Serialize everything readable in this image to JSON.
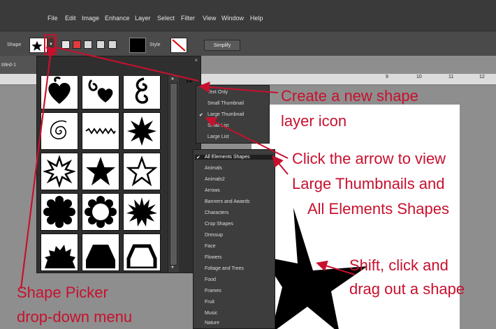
{
  "menu": {
    "items": [
      "File",
      "Edit",
      "Image",
      "Enhance",
      "Layer",
      "Select",
      "Filter",
      "View",
      "Window",
      "Help"
    ]
  },
  "options_bar": {
    "shape_label": "Shape",
    "style_label": "Style",
    "simplify_label": "Simplify"
  },
  "document": {
    "tab_title": "titled-1",
    "ruler_numbers": [
      "9",
      "10",
      "11",
      "12"
    ]
  },
  "picker": {
    "close_label": "×",
    "menu_arrow": "▸▸",
    "shapes": [
      "heart-flourish-icon",
      "heart-scroll-icon",
      "scroll-ornament-icon",
      "spiral-icon",
      "zigzag-line-icon",
      "starburst-icon",
      "burst-outline-icon",
      "star-icon",
      "star-outline-icon",
      "scalloped-circle-icon",
      "scalloped-ring-icon",
      "sunburst-icon",
      "half-burst-icon",
      "trapezoid-icon",
      "trapezoid-outline-icon"
    ]
  },
  "view_menu": {
    "items": [
      {
        "label": "Text Only",
        "checked": false
      },
      {
        "label": "Small Thumbnail",
        "checked": false
      },
      {
        "label": "Large Thumbnail",
        "checked": true
      },
      {
        "label": "Small List",
        "checked": false
      },
      {
        "label": "Large List",
        "checked": false
      }
    ]
  },
  "library_menu": {
    "items": [
      {
        "label": "All Elements Shapes",
        "checked": true
      },
      {
        "label": "Animals",
        "checked": false
      },
      {
        "label": "Animals2",
        "checked": false
      },
      {
        "label": "Arrows",
        "checked": false
      },
      {
        "label": "Banners and Awards",
        "checked": false
      },
      {
        "label": "Characters",
        "checked": false
      },
      {
        "label": "Crop Shapes",
        "checked": false
      },
      {
        "label": "Dressup",
        "checked": false
      },
      {
        "label": "Face",
        "checked": false
      },
      {
        "label": "Flowers",
        "checked": false
      },
      {
        "label": "Foliage and Trees",
        "checked": false
      },
      {
        "label": "Food",
        "checked": false
      },
      {
        "label": "Frames",
        "checked": false
      },
      {
        "label": "Fruit",
        "checked": false
      },
      {
        "label": "Music",
        "checked": false
      },
      {
        "label": "Nature",
        "checked": false
      }
    ]
  },
  "annotations": {
    "create_line1": "Create a new shape",
    "create_line2": "layer icon",
    "click_line1": "Click the arrow to view",
    "click_line2": "Large Thumbnails and",
    "click_line3": "All Elements Shapes",
    "shift_line1": "Shift, click and",
    "shift_line2": "drag out a shape",
    "picker_line1": "Shape Picker",
    "picker_line2": "drop-down menu"
  },
  "colors": {
    "annotation_red": "#c8102e",
    "menubar": "#3a3a3a",
    "panel": "#2f2f2f"
  }
}
